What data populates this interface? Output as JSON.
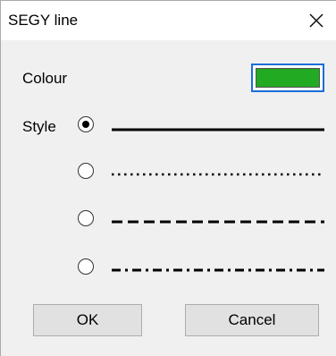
{
  "window": {
    "title": "SEGY line",
    "close_icon": "close-icon"
  },
  "colour": {
    "label": "Colour",
    "value": "#22aa22"
  },
  "style": {
    "label": "Style",
    "options": [
      {
        "pattern": "solid",
        "selected": true
      },
      {
        "pattern": "dotted",
        "selected": false
      },
      {
        "pattern": "dashed",
        "selected": false
      },
      {
        "pattern": "dash-dot",
        "selected": false
      }
    ]
  },
  "buttons": {
    "ok_label": "OK",
    "cancel_label": "Cancel"
  }
}
